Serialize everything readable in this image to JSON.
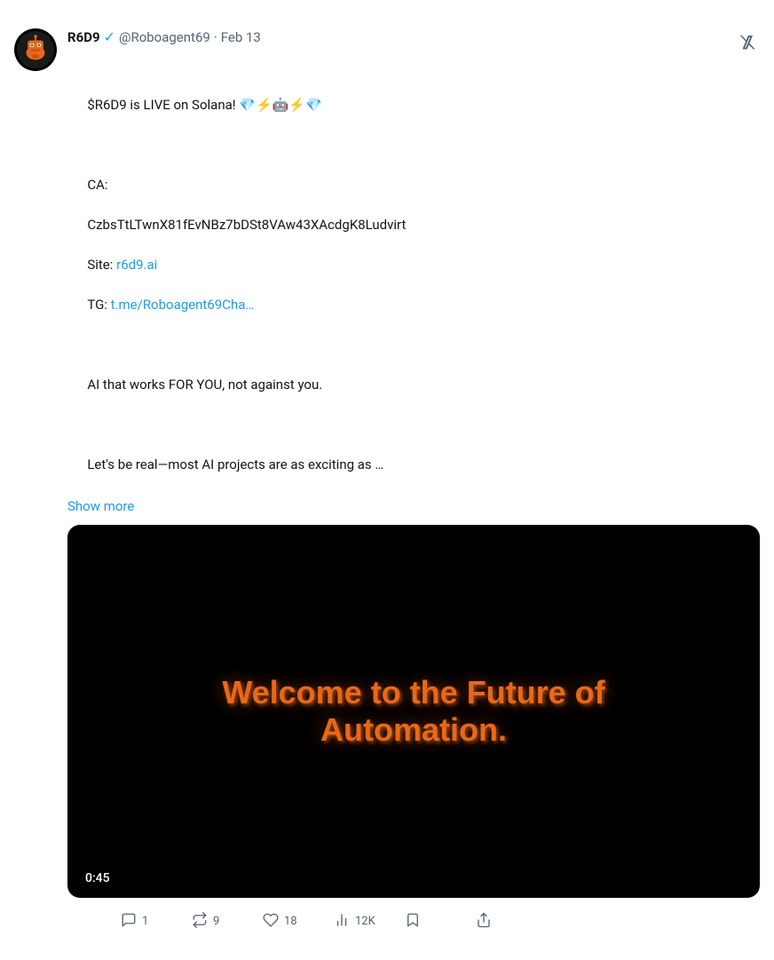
{
  "tweet": {
    "user": {
      "name": "R6D9",
      "handle": "@Roboagent69",
      "date": "Feb 13",
      "verified": true
    },
    "text_line1": "$R6D9 is LIVE on Solana! 💎⚡🤖⚡💎",
    "text_body": "CA:\nCzbsTtLTwnX81fEvNBz7bDSt8VAw43XAcdgK8Ludvirt\nSite: r6d9.ai\nTG: t.me/Roboagent69Cha…\n\nAI that works FOR YOU, not against you.\n\nLet's be real—most AI projects are as exciting as …",
    "site_link_text": "r6d9.ai",
    "tg_link_text": "t.me/Roboagent69Cha…",
    "show_more": "Show more",
    "video": {
      "title_line1": "Welcome to the Future of",
      "title_line2": "Automation.",
      "duration": "0:45"
    },
    "actions": {
      "comment_count": "1",
      "retweet_count": "9",
      "like_count": "18",
      "views_count": "12K",
      "comment_label": "1",
      "retweet_label": "9",
      "like_label": "18",
      "views_label": "12K"
    }
  }
}
